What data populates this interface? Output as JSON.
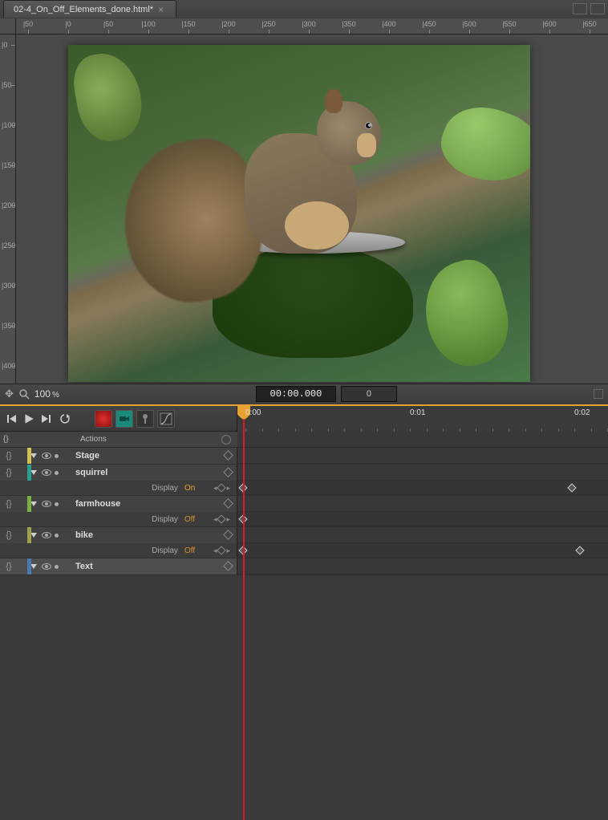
{
  "tab": {
    "title": "02-4_On_Off_Elements_done.html*"
  },
  "rulers": {
    "h": [
      "|50",
      "|0",
      "|50",
      "|100",
      "|150",
      "|200",
      "|250",
      "|300",
      "|350",
      "|400",
      "|450",
      "|500",
      "|550",
      "|600",
      "|650"
    ],
    "v": [
      "|0",
      "|50",
      "|100",
      "|150",
      "|200",
      "|250",
      "|300",
      "|350",
      "|400"
    ]
  },
  "status": {
    "zoom": "100",
    "zoom_suffix": "%",
    "time": "00:00.000",
    "frame": "0"
  },
  "timeline": {
    "ruler": [
      "0:00",
      "0:01",
      "0:02"
    ],
    "actions_label": "Actions",
    "layers": [
      {
        "name": "Stage",
        "color": "c-yellow",
        "props": []
      },
      {
        "name": "squirrel",
        "color": "c-teal",
        "props": [
          {
            "label": "Display",
            "value": "On",
            "on": true,
            "kf": [
              0,
              410
            ]
          }
        ]
      },
      {
        "name": "farmhouse",
        "color": "c-green",
        "props": [
          {
            "label": "Display",
            "value": "Off",
            "on": false,
            "kf": [
              0
            ]
          }
        ]
      },
      {
        "name": "bike",
        "color": "c-olive",
        "props": [
          {
            "label": "Display",
            "value": "Off",
            "on": false,
            "kf": [
              0,
              420
            ]
          }
        ]
      },
      {
        "name": "Text",
        "color": "c-blue",
        "props": []
      }
    ]
  }
}
